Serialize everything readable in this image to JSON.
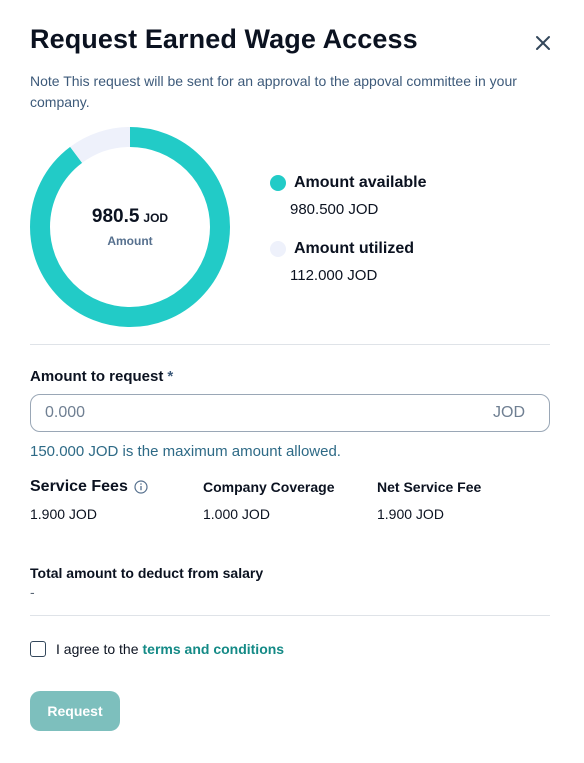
{
  "modal": {
    "title": "Request Earned Wage Access",
    "note": "Note This request will be sent for an approval to the appoval committee in your company."
  },
  "summary": {
    "center_value": "980.5",
    "center_unit": "JOD",
    "center_label": "Amount",
    "available_label": "Amount available",
    "available_value": "980.500 JOD",
    "utilized_label": "Amount utilized",
    "utilized_value": "112.000 JOD",
    "available_color": "#22cbc7",
    "utilized_color": "#eef1fb"
  },
  "chart_data": {
    "type": "pie",
    "categories": [
      "Amount available",
      "Amount utilized"
    ],
    "values": [
      980.5,
      112
    ],
    "colors": [
      "#22cbc7",
      "#eef1fb"
    ]
  },
  "request": {
    "label": "Amount to request",
    "required_marker": "*",
    "placeholder": "0.000",
    "value": "",
    "unit": "JOD",
    "hint": "150.000 JOD is the maximum amount allowed."
  },
  "fees": {
    "service_fees_label": "Service Fees",
    "service_fees_value": "1.900 JOD",
    "company_coverage_label": "Company Coverage",
    "company_coverage_value": "1.000 JOD",
    "net_service_fee_label": "Net Service Fee",
    "net_service_fee_value": "1.900 JOD"
  },
  "total": {
    "label": "Total amount to deduct from salary",
    "value": "-"
  },
  "agreement": {
    "checked": false,
    "text": "I agree to the",
    "link": "terms and conditions"
  },
  "actions": {
    "request_label": "Request"
  },
  "icons": {
    "close": "close-icon",
    "info": "info-icon"
  }
}
